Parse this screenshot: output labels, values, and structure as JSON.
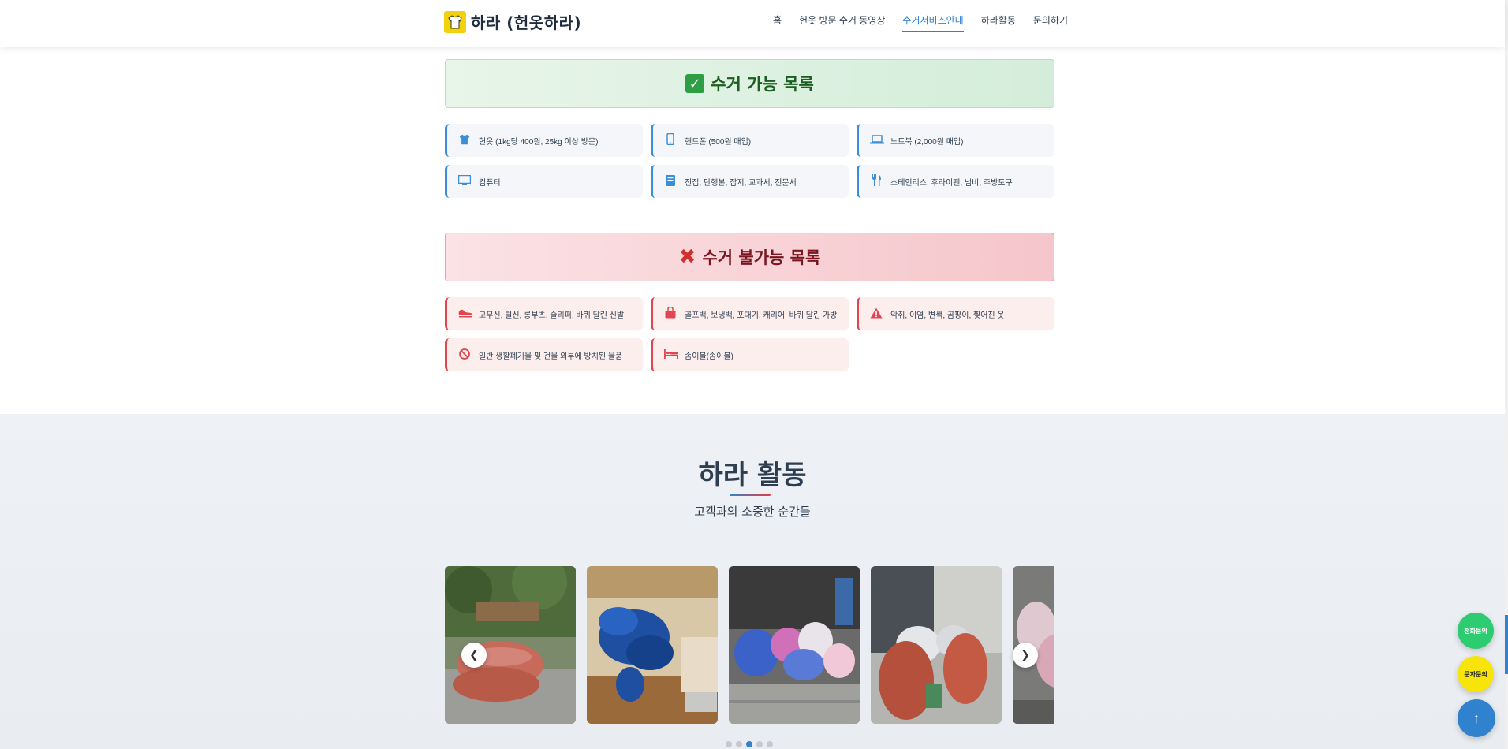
{
  "header": {
    "logo_text": "하라 (헌옷하라)",
    "logo_icon": "tshirt-icon",
    "nav": [
      {
        "label": "홈",
        "active": false
      },
      {
        "label": "헌옷 방문 수거 동영상",
        "active": false
      },
      {
        "label": "수거서비스안내",
        "active": true
      },
      {
        "label": "하라활동",
        "active": false
      },
      {
        "label": "문의하기",
        "active": false
      }
    ]
  },
  "accepted": {
    "title": "수거 가능 목록",
    "items": [
      {
        "label": "헌옷 (1kg당 400원, 25kg 이상 방문)",
        "icon": "tshirt-icon"
      },
      {
        "label": "핸드폰 (500원 매입)",
        "icon": "mobile-icon"
      },
      {
        "label": "노트북 (2,000원 매입)",
        "icon": "laptop-icon"
      },
      {
        "label": "컴퓨터",
        "icon": "desktop-icon"
      },
      {
        "label": "전집, 단행본, 잡지, 교과서, 전문서",
        "icon": "book-icon"
      },
      {
        "label": "스테인리스, 후라이팬, 냄비, 주방도구",
        "icon": "utensils-icon"
      }
    ]
  },
  "rejected": {
    "title": "수거 불가능 목록",
    "items": [
      {
        "label": "고무신, 털신, 롱부츠, 슬리퍼, 바퀴 달린 신발",
        "icon": "shoe-icon"
      },
      {
        "label": "골프백, 보냉백, 포대기, 캐리어, 바퀴 달린 가방",
        "icon": "bag-icon"
      },
      {
        "label": "악취, 이염, 변색, 곰팡이, 찢어진 옷",
        "icon": "warning-icon"
      },
      {
        "label": "일반 생활폐기물 및 건물 외부에 방치된 물품",
        "icon": "ban-icon"
      },
      {
        "label": "솜이불(솜이불)",
        "icon": "bed-icon"
      }
    ]
  },
  "activity": {
    "title": "하라 활동",
    "subtitle": "고객과의 소중한 순간들",
    "slides": [
      "slide-1",
      "slide-2",
      "slide-3",
      "slide-4",
      "slide-5"
    ],
    "active_dot": 3,
    "dot_count": 5
  },
  "floating": {
    "call_label": "전화문의",
    "sms_label": "문자문의",
    "top_icon": "arrow-up-icon"
  },
  "colors": {
    "accent": "#3182ce",
    "ok": "#2e9e44",
    "no": "#e0464f",
    "logo": "#f2d20c"
  }
}
